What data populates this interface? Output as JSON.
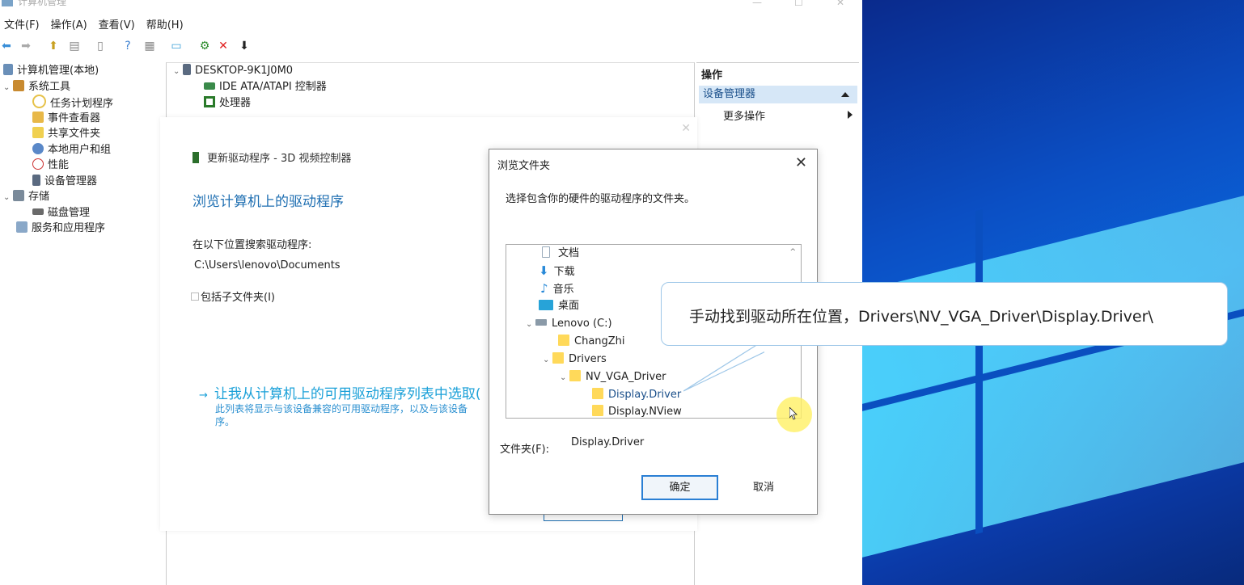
{
  "window": {
    "title_fragment": "计算机管理",
    "menu": [
      "文件(F)",
      "操作(A)",
      "查看(V)",
      "帮助(H)"
    ]
  },
  "toolbar_icons": [
    "back-icon",
    "forward-icon",
    "up-icon",
    "console-tree-icon",
    "export-icon",
    "help-icon",
    "properties-icon",
    "show-hide-icon",
    "scan-hardware-icon",
    "uninstall-icon",
    "disable-icon"
  ],
  "tree": {
    "root": "计算机管理(本地)",
    "items": [
      {
        "label": "系统工具",
        "level": 1,
        "expanded": true
      },
      {
        "label": "任务计划程序",
        "level": 2
      },
      {
        "label": "事件查看器",
        "level": 2
      },
      {
        "label": "共享文件夹",
        "level": 2
      },
      {
        "label": "本地用户和组",
        "level": 2
      },
      {
        "label": "性能",
        "level": 2
      },
      {
        "label": "设备管理器",
        "level": 2
      },
      {
        "label": "存储",
        "level": 1,
        "expanded": true
      },
      {
        "label": "磁盘管理",
        "level": 2
      },
      {
        "label": "服务和应用程序",
        "level": 1
      }
    ]
  },
  "devices": {
    "computer": "DESKTOP-9K1J0M0",
    "items": [
      "IDE ATA/ATAPI 控制器",
      "处理器"
    ]
  },
  "actions": {
    "header": "操作",
    "selected": "设备管理器",
    "more": "更多操作"
  },
  "wizard": {
    "title": "更新驱动程序 - 3D 视频控制器",
    "heading": "浏览计算机上的驱动程序",
    "search_label": "在以下位置搜索驱动程序:",
    "path": "C:\\Users\\lenovo\\Documents",
    "include_subfolders": "包括子文件夹(I)",
    "link": "让我从计算机上的可用驱动程序列表中选取(",
    "link_desc": "此列表将显示与该设备兼容的可用驱动程序，以及与该设备",
    "link_desc2": "序。"
  },
  "browse_dialog": {
    "title": "浏览文件夹",
    "description": "选择包含你的硬件的驱动程序的文件夹。",
    "folders": [
      {
        "label": "文档",
        "icon": "documents-icon"
      },
      {
        "label": "下载",
        "icon": "download-icon"
      },
      {
        "label": "音乐",
        "icon": "music-icon"
      },
      {
        "label": "桌面",
        "icon": "desktop-icon"
      },
      {
        "label": "Lenovo (C:)",
        "icon": "drive-icon"
      },
      {
        "label": "ChangZhi",
        "icon": "folder-icon"
      },
      {
        "label": "Drivers",
        "icon": "folder-icon"
      },
      {
        "label": "NV_VGA_Driver",
        "icon": "folder-icon"
      },
      {
        "label": "Display.Driver",
        "icon": "folder-icon",
        "selected": true
      },
      {
        "label": "Display.NView",
        "icon": "folder-icon"
      }
    ],
    "folder_label": "文件夹(F):",
    "folder_value": "Display.Driver",
    "ok": "确定",
    "cancel": "取消"
  },
  "callout": {
    "text": "手动找到驱动所在位置，Drivers\\NV_VGA_Driver\\Display.Driver\\"
  },
  "colors": {
    "accent_blue": "#1f6fb2",
    "link_blue": "#1aa0d8",
    "selection": "#d6e7f7",
    "folder_yellow": "#ffd95a",
    "delete_red": "#e02020"
  }
}
